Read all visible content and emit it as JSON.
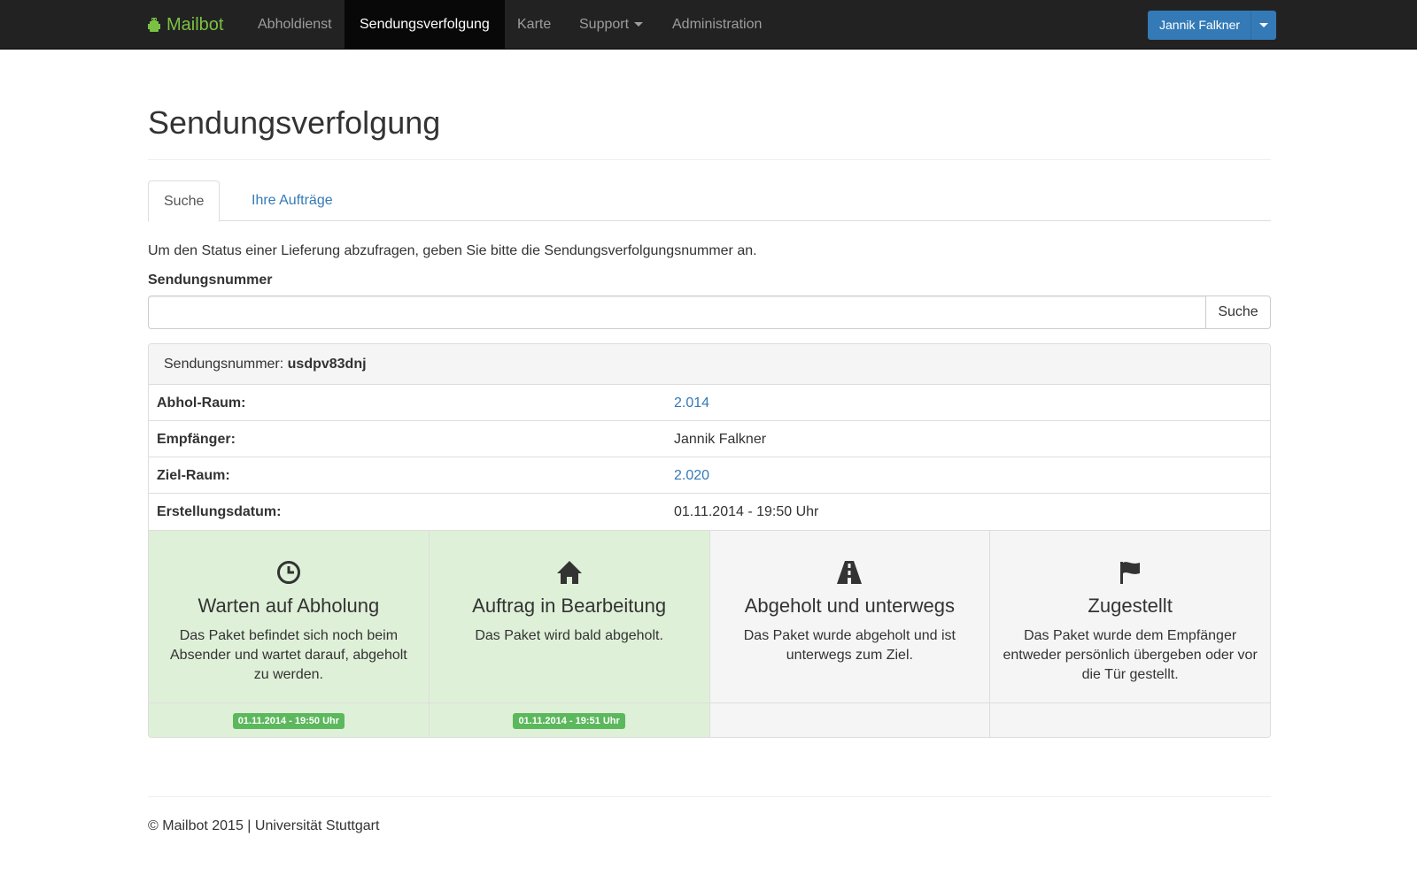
{
  "navbar": {
    "brand": "Mailbot",
    "items": [
      {
        "label": "Abholdienst"
      },
      {
        "label": "Sendungsverfolgung"
      },
      {
        "label": "Karte"
      },
      {
        "label": "Support"
      },
      {
        "label": "Administration"
      }
    ],
    "user": "Jannik Falkner"
  },
  "page": {
    "title": "Sendungsverfolgung",
    "tabs": [
      {
        "label": "Suche"
      },
      {
        "label": "Ihre Aufträge"
      }
    ],
    "intro": "Um den Status einer Lieferung abzufragen, geben Sie bitte die Sendungsverfolgungsnummer an.",
    "field_label": "Sendungsnummer",
    "input_value": "",
    "search_button": "Suche"
  },
  "shipment": {
    "heading_label": "Sendungsnummer:",
    "number": "usdpv83dnj",
    "rows": [
      {
        "key": "Abhol-Raum:",
        "value": "2.014"
      },
      {
        "key": "Empfänger:",
        "value": "Jannik Falkner"
      },
      {
        "key": "Ziel-Raum:",
        "value": "2.020"
      },
      {
        "key": "Erstellungsdatum:",
        "value": "01.11.2014 - 19:50 Uhr"
      }
    ]
  },
  "steps": [
    {
      "icon": "clock-icon",
      "title": "Warten auf Abholung",
      "desc": "Das Paket befindet sich noch beim Absender und wartet darauf, abgeholt zu werden.",
      "time": "01.11.2014 - 19:50 Uhr",
      "done": true
    },
    {
      "icon": "home-icon",
      "title": "Auftrag in Bearbeitung",
      "desc": "Das Paket wird bald abgeholt.",
      "time": "01.11.2014 - 19:51 Uhr",
      "done": true
    },
    {
      "icon": "road-icon",
      "title": "Abgeholt und unterwegs",
      "desc": "Das Paket wurde abgeholt und ist unterwegs zum Ziel.",
      "time": "",
      "done": false
    },
    {
      "icon": "flag-icon",
      "title": "Zugestellt",
      "desc": "Das Paket wurde dem Empfänger entweder persönlich übergeben oder vor die Tür gestellt.",
      "time": "",
      "done": false
    }
  ],
  "footer": "© Mailbot 2015 | Universität Stuttgart",
  "colors": {
    "brand": "#7ac143",
    "navbar": "#222222",
    "primary": "#337ab7",
    "success": "#5cb85c",
    "success_bg": "#dff0d8"
  }
}
